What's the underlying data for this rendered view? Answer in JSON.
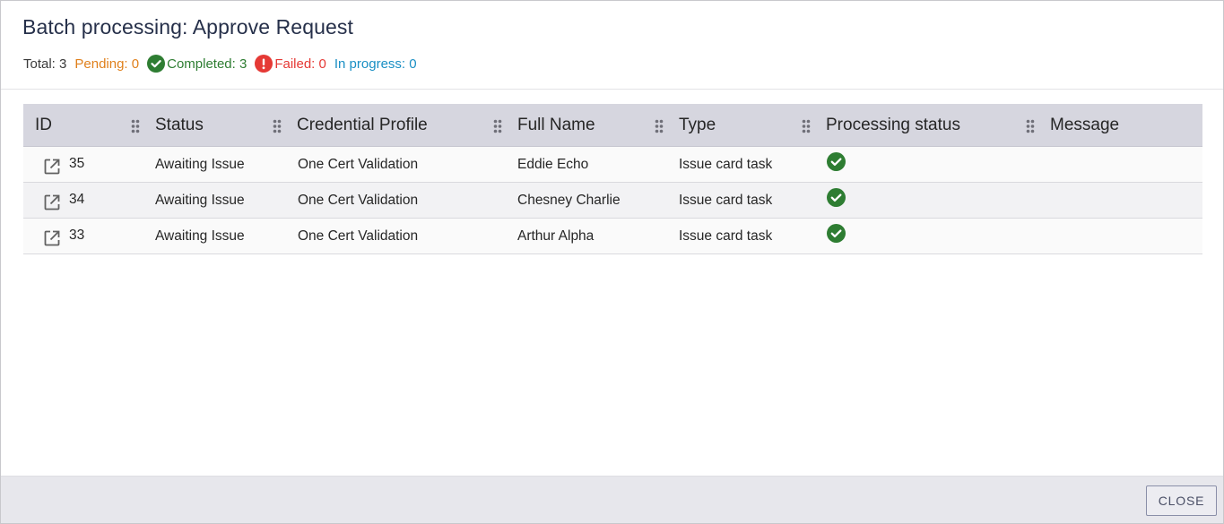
{
  "dialog": {
    "title": "Batch processing: Approve Request",
    "summary": {
      "total": "Total: 3",
      "pending": "Pending: 0",
      "completed": "Completed: 3",
      "failed": "Failed: 0",
      "in_progress": "In progress: 0"
    },
    "colors": {
      "pending": "#e0801c",
      "completed": "#2e7d32",
      "failed": "#e53935",
      "in_progress": "#1a8fc4",
      "header_bg": "#d6d6df"
    }
  },
  "table": {
    "columns": [
      {
        "label": "ID"
      },
      {
        "label": "Status"
      },
      {
        "label": "Credential Profile"
      },
      {
        "label": "Full Name"
      },
      {
        "label": "Type"
      },
      {
        "label": "Processing status"
      },
      {
        "label": "Message"
      }
    ],
    "rows": [
      {
        "id": "35",
        "status": "Awaiting Issue",
        "profile": "One Cert Validation",
        "name": "Eddie Echo",
        "type": "Issue card task",
        "processing": "completed",
        "message": ""
      },
      {
        "id": "34",
        "status": "Awaiting Issue",
        "profile": "One Cert Validation",
        "name": "Chesney Charlie",
        "type": "Issue card task",
        "processing": "completed",
        "message": ""
      },
      {
        "id": "33",
        "status": "Awaiting Issue",
        "profile": "One Cert Validation",
        "name": "Arthur Alpha",
        "type": "Issue card task",
        "processing": "completed",
        "message": ""
      }
    ],
    "icons": {
      "row_link": "open-in-new-icon",
      "processing": "check-circle-icon",
      "column_handle": "drag-handle-icon"
    }
  },
  "footer": {
    "close_label": "CLOSE"
  }
}
